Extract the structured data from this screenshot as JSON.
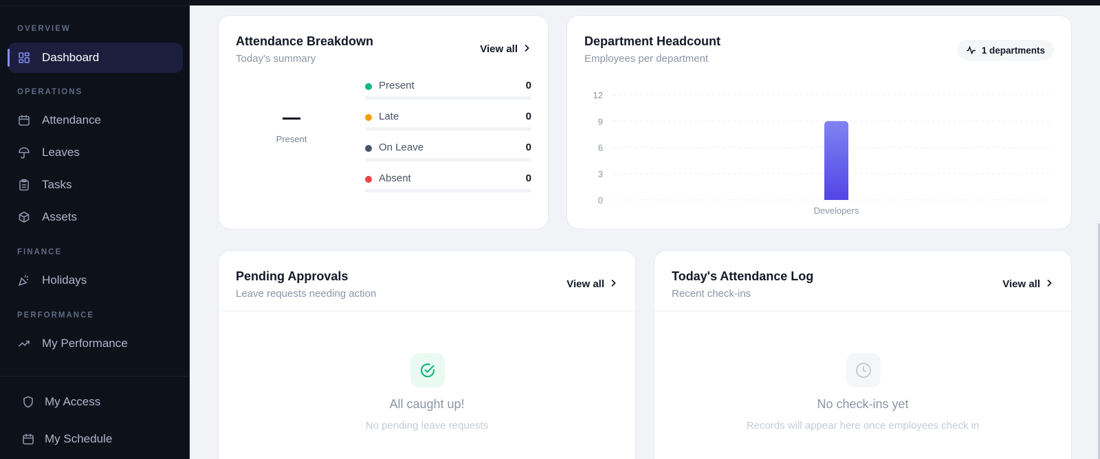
{
  "sidebar": {
    "sections": {
      "overview": "OVERVIEW",
      "operations": "OPERATIONS",
      "finance": "FINANCE",
      "performance": "PERFORMANCE"
    },
    "items": {
      "dashboard": "Dashboard",
      "attendance": "Attendance",
      "leaves": "Leaves",
      "tasks": "Tasks",
      "assets": "Assets",
      "holidays": "Holidays",
      "my_performance": "My Performance"
    },
    "footer": {
      "my_access": "My Access",
      "my_schedule": "My Schedule"
    },
    "active_item": "dashboard"
  },
  "attendance_breakdown": {
    "title": "Attendance Breakdown",
    "subtitle": "Today's summary",
    "view_all": "View all",
    "big_value": "—",
    "big_label": "Present",
    "rows": [
      {
        "label": "Present",
        "value": "0",
        "color": "#10b981"
      },
      {
        "label": "Late",
        "value": "0",
        "color": "#f59e0b"
      },
      {
        "label": "On Leave",
        "value": "0",
        "color": "#475569"
      },
      {
        "label": "Absent",
        "value": "0",
        "color": "#ef4444"
      }
    ]
  },
  "department_headcount": {
    "title": "Department Headcount",
    "subtitle": "Employees per department",
    "badge": "1 departments"
  },
  "chart_data": {
    "type": "bar",
    "categories": [
      "Developers"
    ],
    "values": [
      9
    ],
    "y_ticks": [
      0,
      3,
      6,
      9,
      12
    ],
    "ylim": [
      0,
      12
    ],
    "grid": true,
    "color_top": "#8083f1",
    "color_bottom": "#5245e6"
  },
  "pending_approvals": {
    "title": "Pending Approvals",
    "subtitle": "Leave requests needing action",
    "view_all": "View all",
    "empty_title": "All caught up!",
    "empty_sub": "No pending leave requests"
  },
  "attendance_log": {
    "title": "Today's Attendance Log",
    "subtitle": "Recent check-ins",
    "view_all": "View all",
    "empty_title": "No check-ins yet",
    "empty_sub": "Records will appear here once employees check in"
  }
}
